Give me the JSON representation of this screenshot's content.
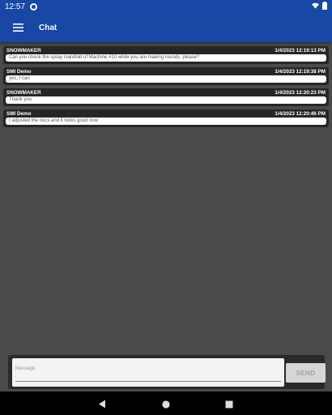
{
  "status": {
    "time": "12:57"
  },
  "appbar": {
    "title": "Chat",
    "menu_icon": "hamburger-menu-icon"
  },
  "messages": [
    {
      "sender": "SNOWMAKER",
      "timestamp": "1/4/2023 12:19:13 PM",
      "text": "Can you check the spray manifold of Machine #10 while you are making rounds, please?"
    },
    {
      "sender": "SMI Demo",
      "timestamp": "1/4/2023 12:19:38 PM",
      "text": "yes, I can"
    },
    {
      "sender": "SNOWMAKER",
      "timestamp": "1/4/2023 12:20:23 PM",
      "text": "Thank you"
    },
    {
      "sender": "SMI Demo",
      "timestamp": "1/4/2023 12:20:46 PM",
      "text": "I adjusted the nucs and it looks good now"
    }
  ],
  "compose": {
    "placeholder": "Message",
    "send_label": "SEND"
  },
  "colors": {
    "primary": "#1847a6",
    "background": "#4a4a4a",
    "message_header": "#262626"
  }
}
